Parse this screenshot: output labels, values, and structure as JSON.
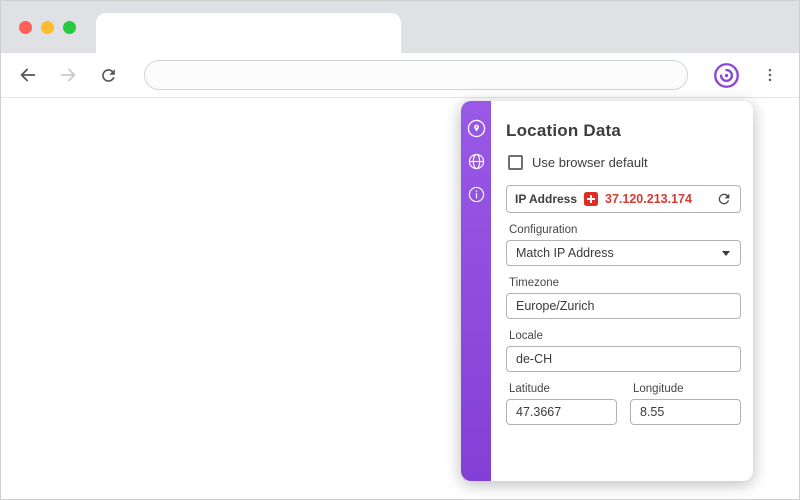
{
  "browser": {
    "window_controls": [
      "close",
      "minimize",
      "zoom"
    ],
    "toolbar": {
      "back_icon": "back-arrow",
      "forward_icon": "forward-arrow",
      "reload_icon": "reload",
      "address_value": "",
      "extension_icon": "vytal-logo",
      "menu_icon": "kebab-menu"
    }
  },
  "panel": {
    "title": "Location Data",
    "browser_default": {
      "label": "Use browser default",
      "checked": false
    },
    "sidebar_icons": [
      "location-pin",
      "globe",
      "info"
    ],
    "ip": {
      "label": "IP Address",
      "value": "37.120.213.174",
      "flag": "switzerland-flag"
    },
    "configuration": {
      "label": "Configuration",
      "value": "Match IP Address"
    },
    "timezone": {
      "label": "Timezone",
      "value": "Europe/Zurich"
    },
    "locale": {
      "label": "Locale",
      "value": "de-CH"
    },
    "latitude": {
      "label": "Latitude",
      "value": "47.3667"
    },
    "longitude": {
      "label": "Longitude",
      "value": "8.55"
    }
  },
  "colors": {
    "accent": "#8a46da",
    "ip_text": "#d63a32",
    "flag_red": "#e02d23"
  }
}
